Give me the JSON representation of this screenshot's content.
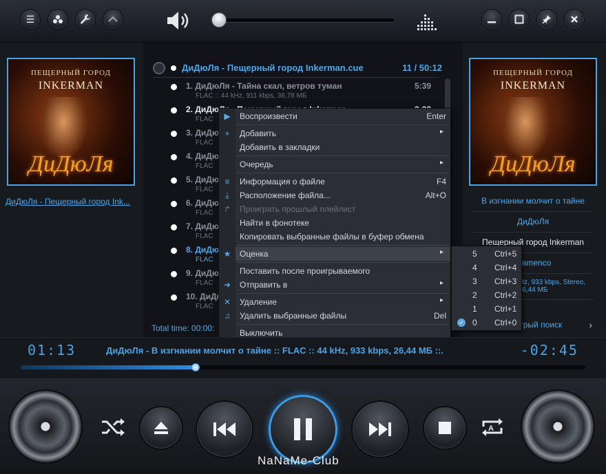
{
  "top": {
    "left_buttons": [
      "menu-icon",
      "playlists-icon",
      "wrench-icon",
      "chevron-up-icon"
    ],
    "right_buttons": [
      "minimize-icon",
      "maximize-icon",
      "pin-icon",
      "close-icon"
    ],
    "volume_fraction": 0.03
  },
  "cover": {
    "subtitle": "ПЕЩЕРНЫЙ ГОРОД",
    "title": "INKERMAN",
    "band": "ДиДюЛя"
  },
  "left": {
    "album_link": "ДиДюЛя - Пещерный город Ink..."
  },
  "right": {
    "rows": [
      "В изгнании молчит о тайне",
      "ДиДюЛя",
      "Пещерный город Inkerman",
      "Flamenco",
      "FLAC :: 44 kHz, 933 kbps, Stereo, 26,44 МБ",
      "Быстрый поиск"
    ]
  },
  "playlist": {
    "title": "ДиДюЛя - Пещерный город Inkerman.cue",
    "count": "11 / 50:12",
    "tracks": [
      {
        "title": "1. ДиДюЛя - Тайна скал, ветров туман",
        "info": "FLAC :: 44 kHz, 911 kbps, 36,78 МБ",
        "duration": "5:39"
      },
      {
        "title": "2. ДиДюЛя - Пещерный город Inkerman",
        "info": "FLAC",
        "duration": "3:33"
      },
      {
        "title": "3. ДиДюЛя",
        "info": "FLAC",
        "duration": ""
      },
      {
        "title": "4. ДиДюЛя",
        "info": "FLAC",
        "duration": ""
      },
      {
        "title": "5. ДиДюЛя",
        "info": "FLAC",
        "duration": ""
      },
      {
        "title": "6. ДиДюЛя",
        "info": "FLAC",
        "duration": ""
      },
      {
        "title": "7. ДиДюЛя",
        "info": "FLAC",
        "duration": ""
      },
      {
        "title": "8. ДиДюЛя",
        "info": "FLAC",
        "duration": ""
      },
      {
        "title": "9. ДиДюЛя",
        "info": "FLAC",
        "duration": ""
      },
      {
        "title": "10. ДиДюЛя",
        "info": "FLAC",
        "duration": ""
      }
    ],
    "total": "Total time: 00:00:"
  },
  "menu": {
    "play": {
      "label": "Воспроизвести",
      "shortcut": "Enter"
    },
    "add": "Добавить",
    "bookmark": "Добавить в закладки",
    "queue": "Очередь",
    "file_info": {
      "label": "Информация о файле",
      "shortcut": "F4"
    },
    "file_location": {
      "label": "Расположение файла...",
      "shortcut": "Alt+O"
    },
    "prev_playlist": "Проиграть прошлый плейлист",
    "find_library": "Найти в фонотеке",
    "copy_files": "Копировать выбранные файлы в буфер обмена",
    "rating": "Оценка",
    "play_after": "Поставить после проигрываемого",
    "send_to": "Отправить в",
    "remove": "Удаление",
    "delete_files": {
      "label": "Удалить выбранные файлы",
      "shortcut": "Del"
    },
    "shutdown": "Выключить"
  },
  "rating_menu": [
    {
      "n": "5",
      "key": "Ctrl+5"
    },
    {
      "n": "4",
      "key": "Ctrl+4"
    },
    {
      "n": "3",
      "key": "Ctrl+3"
    },
    {
      "n": "2",
      "key": "Ctrl+2"
    },
    {
      "n": "1",
      "key": "Ctrl+1"
    },
    {
      "n": "0",
      "key": "Ctrl+0"
    }
  ],
  "status": {
    "elapsed": "01:13",
    "remaining": "-02:45",
    "now_playing": "ДиДюЛя - В изгнании молчит о тайне :: FLAC :: 44 kHz, 933 kbps, 26,44 МБ ::.",
    "progress_fraction": 0.31
  },
  "brand": "NaNaMe-Club",
  "colors": {
    "accent": "#4aa3e6",
    "background": "#111318"
  }
}
